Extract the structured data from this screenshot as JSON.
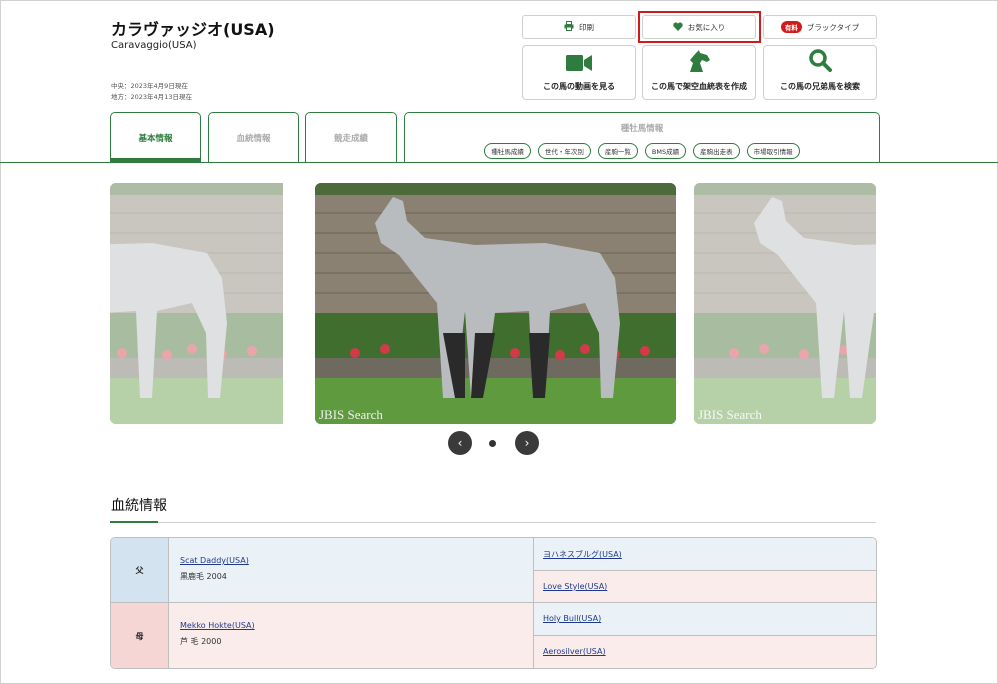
{
  "horse": {
    "name": "カラヴァッジオ(USA)",
    "name_en": "Caravaggio(USA)",
    "date_central": "中央：2023年4月9日現在",
    "date_local": "地方：2023年4月13日現在"
  },
  "actions": {
    "print": "印刷",
    "favorite": "お気に入り",
    "paid_badge": "有料",
    "blacktype": "ブラックタイプ",
    "video": "この馬の動画を見る",
    "virtual_pedigree": "この馬で架空血統表を作成",
    "siblings": "この馬の兄弟馬を検索"
  },
  "tabs": {
    "basic": "基本情報",
    "bloodline": "血統情報",
    "race": "競走成績",
    "stallion": "種牡馬情報",
    "stallion_links": [
      "種牡馬成績",
      "世代・年次別",
      "産駒一覧",
      "BMS成績",
      "産駒出走表",
      "市場取引情報"
    ]
  },
  "gallery": {
    "watermark": "JBIS Search",
    "prev_symbol": "‹",
    "next_symbol": "›"
  },
  "pedigree": {
    "title": "血統情報",
    "sire_label": "父",
    "dam_label": "母",
    "sire": {
      "name": "Scat Daddy(USA)",
      "info": "黒鹿毛 2004"
    },
    "dam": {
      "name": "Mekko Hokte(USA)",
      "info": "芦 毛 2000"
    },
    "grandparents": [
      "ヨハネスブルグ(USA)",
      "Love Style(USA)",
      "Holy Bull(USA)",
      "Aerosilver(USA)"
    ]
  },
  "colors": {
    "brand_green": "#2e7d3e",
    "highlight_red": "#d11a1a",
    "sire_blue": "#d3e3f0",
    "dam_pink": "#f6d5d5"
  }
}
